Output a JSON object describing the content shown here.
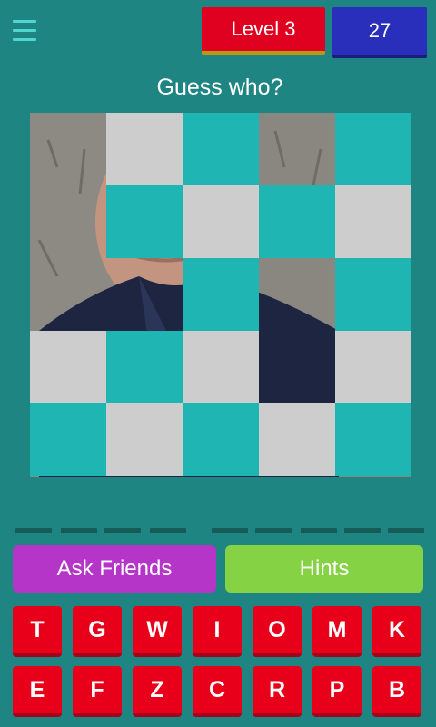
{
  "header": {
    "menu_icon": "hamburger-menu-icon",
    "level_label": "Level 3",
    "coins": "27"
  },
  "prompt": "Guess who?",
  "puzzle": {
    "rows": 5,
    "cols": 5,
    "tiles": [
      [
        "revealed",
        "gray",
        "teal",
        "revealed",
        "teal"
      ],
      [
        "revealed",
        "teal",
        "gray",
        "teal",
        "gray"
      ],
      [
        "revealed",
        "revealed",
        "teal",
        "revealed",
        "teal"
      ],
      [
        "gray",
        "teal",
        "gray",
        "revealed",
        "gray"
      ],
      [
        "teal",
        "gray",
        "teal",
        "gray",
        "teal"
      ]
    ]
  },
  "answer_slot_count": 9,
  "actions": {
    "ask_friends": "Ask Friends",
    "hints": "Hints"
  },
  "keyboard": {
    "row1": [
      "T",
      "G",
      "W",
      "I",
      "O",
      "M",
      "K"
    ],
    "row2": [
      "E",
      "F",
      "Z",
      "C",
      "R",
      "P",
      "B"
    ]
  },
  "colors": {
    "background": "#1e8582",
    "tile_teal": "#1fb5b2",
    "tile_gray": "#cdcdcd",
    "level_badge": "#e0001f",
    "coins_badge": "#2a2fbb",
    "ask_friends": "#b535c8",
    "hints": "#85d244",
    "letter_key": "#e8001a"
  }
}
